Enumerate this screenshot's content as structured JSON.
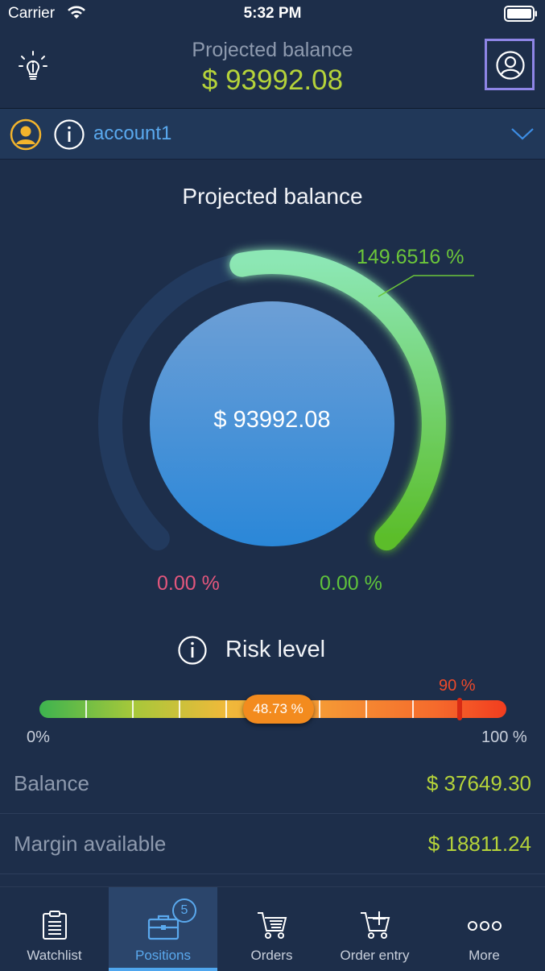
{
  "status_bar": {
    "carrier": "Carrier",
    "time": "5:32 PM"
  },
  "header": {
    "title": "Projected balance",
    "balance": "$ 93992.08",
    "balance_color": "#b5d33a"
  },
  "account": {
    "name": "account1"
  },
  "gauge": {
    "title": "Projected balance",
    "center_value": "$ 93992.08",
    "top_percent": "149.6516 %",
    "left_percent": "0.00 %",
    "right_percent": "0.00 %",
    "fill_fraction": 0.54
  },
  "risk": {
    "title": "Risk level",
    "current": "48.73 %",
    "current_value": 48.73,
    "limit": "90 %",
    "limit_value": 90,
    "min_label": "0%",
    "max_label": "100 %"
  },
  "rows": [
    {
      "label": "Balance",
      "value": "$ 37649.30"
    },
    {
      "label": "Margin available",
      "value": "$ 18811.24"
    }
  ],
  "tabs": [
    {
      "label": "Watchlist",
      "icon": "clipboard-icon"
    },
    {
      "label": "Positions",
      "icon": "briefcase-icon",
      "badge": "5",
      "active": true
    },
    {
      "label": "Orders",
      "icon": "cart-list-icon"
    },
    {
      "label": "Order entry",
      "icon": "cart-plus-icon"
    },
    {
      "label": "More",
      "icon": "more-dots-icon"
    }
  ]
}
